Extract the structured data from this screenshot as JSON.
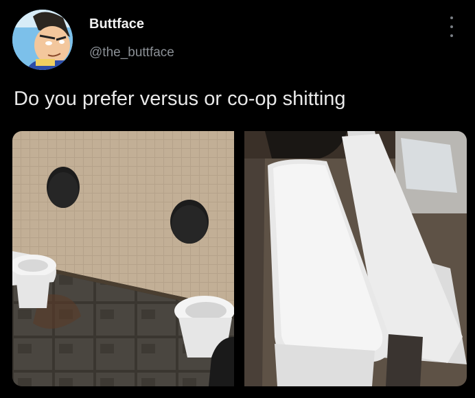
{
  "author": {
    "display_name": "Buttface",
    "handle": "@the_buttface"
  },
  "tweet": {
    "text": "Do you prefer versus or co-op shitting"
  },
  "icons": {
    "more": "more-vertical-icon"
  },
  "colors": {
    "background": "#000000",
    "text": "#e7e9ea",
    "secondary_text": "#8b9096"
  }
}
